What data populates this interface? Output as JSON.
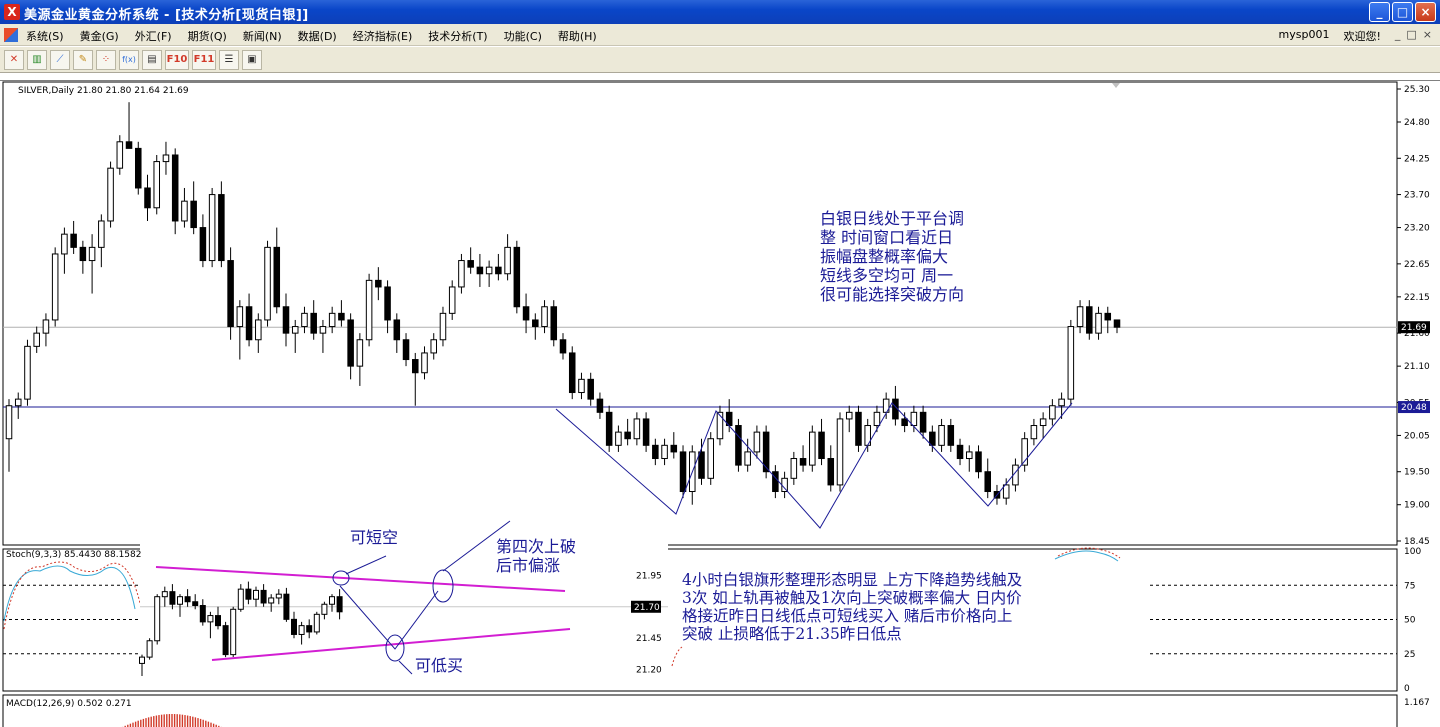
{
  "window": {
    "app_icon": "X",
    "title": "美源金业黄金分析系统 - [技术分析[现货白银]]",
    "buttons": [
      "_",
      "□",
      "×"
    ]
  },
  "menu": {
    "items": [
      "系统(S)",
      "黄金(G)",
      "外汇(F)",
      "期货(Q)",
      "新闻(N)",
      "数据(D)",
      "经济指标(E)",
      "技术分析(T)",
      "功能(C)",
      "帮助(H)"
    ],
    "user": "mysp001",
    "welcome": "欢迎您!",
    "mdi_controls": [
      "_",
      "□",
      "×"
    ]
  },
  "toolbar": {
    "icons": [
      "close-chart-icon",
      "bar-chart-icon",
      "line-chart-icon",
      "draw-icon",
      "grid-icon",
      "formula-icon",
      "print-icon",
      "f10-icon",
      "f11-icon",
      "list-icon",
      "window-icon"
    ],
    "f10_label": "F10",
    "f11_label": "F11",
    "formula_label": "f(x)"
  },
  "chart": {
    "symbol_header": "SILVER,Daily  21.80 21.80 21.64 21.69",
    "price_axis_ticks": [
      "25.30",
      "24.80",
      "24.25",
      "23.70",
      "23.20",
      "22.65",
      "22.15",
      "21.60",
      "21.10",
      "20.55",
      "20.05",
      "19.50",
      "19.00",
      "18.45"
    ],
    "current_price": "21.69",
    "level_price": "20.48",
    "stoch_header": "Stoch(9,3,3) 85.4430 88.1582",
    "stoch_axis": [
      "100",
      "75",
      "50",
      "25",
      "0"
    ],
    "macd_header": "MACD(12,26,9) 0.502 0.271",
    "macd_axis": "1.167",
    "inset_axis": [
      "21.95",
      "21.70",
      "21.45",
      "21.20"
    ],
    "inset_current": "21.70",
    "colors": {
      "up_candle": "#ffffff",
      "down_candle": "#000000",
      "trendline": "#1b1b96",
      "flag_line": "#d21ed2",
      "stoch_main": "#39a9d6",
      "stoch_signal": "#d23a2a"
    }
  },
  "annotations": {
    "main_note": [
      "白银日线处于平台调",
      "整 时间窗口看近日",
      "振幅盘整概率偏大",
      "短线多空均可 周一",
      "很可能选择突破方向"
    ],
    "short_label": "可短空",
    "breakout_label": [
      "第四次上破",
      "后市偏涨"
    ],
    "buy_label": "可低买",
    "sub_note": [
      "4小时白银旗形整理形态明显 上方下降趋势线触及",
      "3次 如上轨再被触及1次向上突破概率偏大 日内价",
      "格接近昨日日线低点可短线买入 赌后市价格向上",
      "突破 止损略低于21.35昨日低点"
    ]
  },
  "chart_data": {
    "type": "candlestick",
    "title": "SILVER,Daily",
    "ylim": [
      18.45,
      25.3
    ],
    "ohlc": [
      [
        20.0,
        20.6,
        19.5,
        20.5
      ],
      [
        20.5,
        20.7,
        20.3,
        20.6
      ],
      [
        20.6,
        21.5,
        20.5,
        21.4
      ],
      [
        21.4,
        21.7,
        21.3,
        21.6
      ],
      [
        21.6,
        21.9,
        21.4,
        21.8
      ],
      [
        21.8,
        22.9,
        21.7,
        22.8
      ],
      [
        22.8,
        23.2,
        22.5,
        23.1
      ],
      [
        23.1,
        23.3,
        22.8,
        22.9
      ],
      [
        22.9,
        23.0,
        22.5,
        22.7
      ],
      [
        22.7,
        23.1,
        22.2,
        22.9
      ],
      [
        22.9,
        23.4,
        22.6,
        23.3
      ],
      [
        23.3,
        24.2,
        23.2,
        24.1
      ],
      [
        24.1,
        24.6,
        24.0,
        24.5
      ],
      [
        24.5,
        25.1,
        24.4,
        24.4
      ],
      [
        24.4,
        24.5,
        23.7,
        23.8
      ],
      [
        23.8,
        24.0,
        23.3,
        23.5
      ],
      [
        23.5,
        24.3,
        23.4,
        24.2
      ],
      [
        24.2,
        24.5,
        24.0,
        24.3
      ],
      [
        24.3,
        24.4,
        23.1,
        23.3
      ],
      [
        23.3,
        23.8,
        23.2,
        23.6
      ],
      [
        23.6,
        23.9,
        23.1,
        23.2
      ],
      [
        23.2,
        23.4,
        22.6,
        22.7
      ],
      [
        22.7,
        23.8,
        22.6,
        23.7
      ],
      [
        23.7,
        23.9,
        22.6,
        22.7
      ],
      [
        22.7,
        22.9,
        21.5,
        21.7
      ],
      [
        21.7,
        22.1,
        21.2,
        22.0
      ],
      [
        22.0,
        22.2,
        21.4,
        21.5
      ],
      [
        21.5,
        21.9,
        21.3,
        21.8
      ],
      [
        21.8,
        23.0,
        21.7,
        22.9
      ],
      [
        22.9,
        23.2,
        21.9,
        22.0
      ],
      [
        22.0,
        22.2,
        21.4,
        21.6
      ],
      [
        21.6,
        21.8,
        21.3,
        21.7
      ],
      [
        21.7,
        22.0,
        21.6,
        21.9
      ],
      [
        21.9,
        22.1,
        21.5,
        21.6
      ],
      [
        21.6,
        21.8,
        21.3,
        21.7
      ],
      [
        21.7,
        22.0,
        21.6,
        21.9
      ],
      [
        21.9,
        22.1,
        21.7,
        21.8
      ],
      [
        21.8,
        21.9,
        20.9,
        21.1
      ],
      [
        21.1,
        21.6,
        20.8,
        21.5
      ],
      [
        21.5,
        22.5,
        21.4,
        22.4
      ],
      [
        22.4,
        22.6,
        22.1,
        22.3
      ],
      [
        22.3,
        22.4,
        21.6,
        21.8
      ],
      [
        21.8,
        21.9,
        21.3,
        21.5
      ],
      [
        21.5,
        21.6,
        21.1,
        21.2
      ],
      [
        21.2,
        21.3,
        20.5,
        21.0
      ],
      [
        21.0,
        21.4,
        20.9,
        21.3
      ],
      [
        21.3,
        21.6,
        21.2,
        21.5
      ],
      [
        21.5,
        22.0,
        21.4,
        21.9
      ],
      [
        21.9,
        22.4,
        21.8,
        22.3
      ],
      [
        22.3,
        22.8,
        22.2,
        22.7
      ],
      [
        22.7,
        22.9,
        22.5,
        22.6
      ],
      [
        22.6,
        22.8,
        22.3,
        22.5
      ],
      [
        22.5,
        22.7,
        22.3,
        22.6
      ],
      [
        22.6,
        22.8,
        22.4,
        22.5
      ],
      [
        22.5,
        23.1,
        22.4,
        22.9
      ],
      [
        22.9,
        23.0,
        21.9,
        22.0
      ],
      [
        22.0,
        22.2,
        21.6,
        21.8
      ],
      [
        21.8,
        21.9,
        21.5,
        21.7
      ],
      [
        21.7,
        22.1,
        21.6,
        22.0
      ],
      [
        22.0,
        22.1,
        21.4,
        21.5
      ],
      [
        21.5,
        21.6,
        21.2,
        21.3
      ],
      [
        21.3,
        21.4,
        20.6,
        20.7
      ],
      [
        20.7,
        21.0,
        20.6,
        20.9
      ],
      [
        20.9,
        21.0,
        20.5,
        20.6
      ],
      [
        20.6,
        20.7,
        20.3,
        20.4
      ],
      [
        20.4,
        20.5,
        19.8,
        19.9
      ],
      [
        19.9,
        20.2,
        19.8,
        20.1
      ],
      [
        20.1,
        20.3,
        19.9,
        20.0
      ],
      [
        20.0,
        20.4,
        19.9,
        20.3
      ],
      [
        20.3,
        20.4,
        19.8,
        19.9
      ],
      [
        19.9,
        20.0,
        19.6,
        19.7
      ],
      [
        19.7,
        20.0,
        19.6,
        19.9
      ],
      [
        19.9,
        20.1,
        19.7,
        19.8
      ],
      [
        19.8,
        19.9,
        19.1,
        19.2
      ],
      [
        19.2,
        19.9,
        19.0,
        19.8
      ],
      [
        19.8,
        20.0,
        19.3,
        19.4
      ],
      [
        19.4,
        20.1,
        19.3,
        20.0
      ],
      [
        20.0,
        20.5,
        19.9,
        20.4
      ],
      [
        20.4,
        20.6,
        20.1,
        20.2
      ],
      [
        20.2,
        20.3,
        19.5,
        19.6
      ],
      [
        19.6,
        20.0,
        19.5,
        19.8
      ],
      [
        19.8,
        20.2,
        19.7,
        20.1
      ],
      [
        20.1,
        20.2,
        19.4,
        19.5
      ],
      [
        19.5,
        19.6,
        19.1,
        19.2
      ],
      [
        19.2,
        19.5,
        19.1,
        19.4
      ],
      [
        19.4,
        19.8,
        19.3,
        19.7
      ],
      [
        19.7,
        19.9,
        19.5,
        19.6
      ],
      [
        19.6,
        20.2,
        19.5,
        20.1
      ],
      [
        20.1,
        20.3,
        19.6,
        19.7
      ],
      [
        19.7,
        19.9,
        19.2,
        19.3
      ],
      [
        19.3,
        20.4,
        19.2,
        20.3
      ],
      [
        20.3,
        20.5,
        20.1,
        20.4
      ],
      [
        20.4,
        20.5,
        19.8,
        19.9
      ],
      [
        19.9,
        20.3,
        19.8,
        20.2
      ],
      [
        20.2,
        20.5,
        20.1,
        20.4
      ],
      [
        20.4,
        20.7,
        20.3,
        20.6
      ],
      [
        20.6,
        20.8,
        20.2,
        20.3
      ],
      [
        20.3,
        20.4,
        20.1,
        20.2
      ],
      [
        20.2,
        20.5,
        20.1,
        20.4
      ],
      [
        20.4,
        20.5,
        20.0,
        20.1
      ],
      [
        20.1,
        20.2,
        19.8,
        19.9
      ],
      [
        19.9,
        20.3,
        19.8,
        20.2
      ],
      [
        20.2,
        20.3,
        19.8,
        19.9
      ],
      [
        19.9,
        20.0,
        19.6,
        19.7
      ],
      [
        19.7,
        19.9,
        19.5,
        19.8
      ],
      [
        19.8,
        19.9,
        19.4,
        19.5
      ],
      [
        19.5,
        19.7,
        19.1,
        19.2
      ],
      [
        19.2,
        19.3,
        19.0,
        19.1
      ],
      [
        19.1,
        19.4,
        19.0,
        19.3
      ],
      [
        19.3,
        19.7,
        19.2,
        19.6
      ],
      [
        19.6,
        20.1,
        19.5,
        20.0
      ],
      [
        20.0,
        20.3,
        19.9,
        20.2
      ],
      [
        20.2,
        20.4,
        20.0,
        20.3
      ],
      [
        20.3,
        20.6,
        20.2,
        20.5
      ],
      [
        20.5,
        20.7,
        20.3,
        20.6
      ],
      [
        20.6,
        21.8,
        20.5,
        21.7
      ],
      [
        21.7,
        22.1,
        21.6,
        22.0
      ],
      [
        22.0,
        22.1,
        21.5,
        21.6
      ],
      [
        21.6,
        22.0,
        21.5,
        21.9
      ],
      [
        21.9,
        22.0,
        21.6,
        21.8
      ],
      [
        21.8,
        21.8,
        21.6,
        21.69
      ]
    ],
    "horizontal_levels": [
      21.69,
      20.48
    ]
  }
}
